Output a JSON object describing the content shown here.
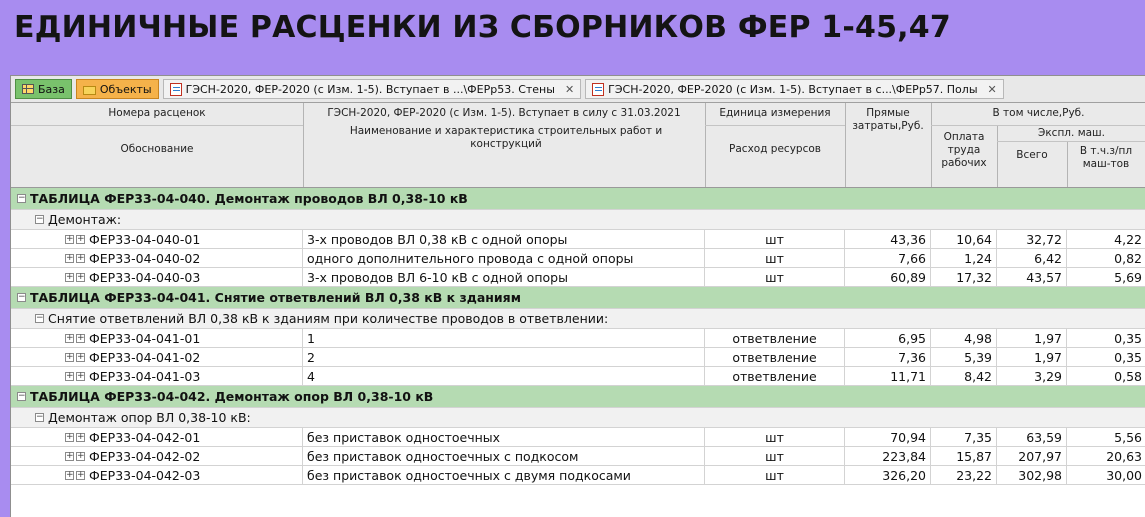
{
  "page_title": "ЕДИНИЧНЫЕ РАСЦЕНКИ ИЗ СБОРНИКОВ ФЕР 1-45,47",
  "tabs": [
    {
      "label": "База",
      "icon": "grid-icon",
      "kind": "baza"
    },
    {
      "label": "Объекты",
      "icon": "folder-icon",
      "kind": "obj"
    },
    {
      "label": "ГЭСН-2020, ФЕР-2020 (с Изм. 1-5). Вступает в ...\\ФЕРр53. Стены",
      "icon": "document-icon",
      "kind": "doc",
      "close": "✕"
    },
    {
      "label": "ГЭСН-2020, ФЕР-2020 (с Изм. 1-5). Вступает в с...\\ФЕРр57. Полы",
      "icon": "document-icon",
      "kind": "doc",
      "close": "✕"
    }
  ],
  "header": {
    "code_top": "Номера расценок",
    "code_bottom": "Обоснование",
    "name_top": "ГЭСН-2020, ФЕР-2020 (с Изм. 1-5). Вступает в силу с 31.03.2021",
    "name_bottom": "Наименование и характеристика строительных работ и конструкций",
    "unit_top": "Единица измерения",
    "unit_bottom": "Расход ресурсов",
    "direct": "Прямые затраты,Руб.",
    "incl": "В том числе,Руб.",
    "wage": "Оплата труда рабочих",
    "mach": "Экспл. маш.",
    "mach_total": "Всего",
    "mach_wage": "В т.ч.з/пл маш-тов"
  },
  "rows": [
    {
      "type": "table",
      "text": "ТАБЛИЦА ФЕР33-04-040. Демонтаж проводов ВЛ 0,38-10 кВ"
    },
    {
      "type": "group",
      "text": "Демонтаж:"
    },
    {
      "type": "item",
      "code": "ФЕР33-04-040-01",
      "name": "3-х проводов ВЛ 0,38 кВ с одной опоры",
      "unit": "шт",
      "direct": "43,36",
      "wage": "10,64",
      "mach": "32,72",
      "mach_wage": "4,22"
    },
    {
      "type": "item",
      "code": "ФЕР33-04-040-02",
      "name": "одного дополнительного провода с одной опоры",
      "unit": "шт",
      "direct": "7,66",
      "wage": "1,24",
      "mach": "6,42",
      "mach_wage": "0,82"
    },
    {
      "type": "item",
      "code": "ФЕР33-04-040-03",
      "name": "3-х проводов ВЛ 6-10 кВ с одной опоры",
      "unit": "шт",
      "direct": "60,89",
      "wage": "17,32",
      "mach": "43,57",
      "mach_wage": "5,69"
    },
    {
      "type": "table",
      "text": "ТАБЛИЦА ФЕР33-04-041. Снятие ответвлений ВЛ 0,38 кВ к зданиям"
    },
    {
      "type": "group",
      "text": "Снятие ответвлений ВЛ 0,38 кВ к зданиям при количестве проводов в ответвлении:"
    },
    {
      "type": "item",
      "code": "ФЕР33-04-041-01",
      "name": "1",
      "unit": "ответвление",
      "direct": "6,95",
      "wage": "4,98",
      "mach": "1,97",
      "mach_wage": "0,35"
    },
    {
      "type": "item",
      "code": "ФЕР33-04-041-02",
      "name": "2",
      "unit": "ответвление",
      "direct": "7,36",
      "wage": "5,39",
      "mach": "1,97",
      "mach_wage": "0,35"
    },
    {
      "type": "item",
      "code": "ФЕР33-04-041-03",
      "name": "4",
      "unit": "ответвление",
      "direct": "11,71",
      "wage": "8,42",
      "mach": "3,29",
      "mach_wage": "0,58"
    },
    {
      "type": "table",
      "text": "ТАБЛИЦА ФЕР33-04-042. Демонтаж опор ВЛ 0,38-10 кВ"
    },
    {
      "type": "group",
      "text": "Демонтаж опор ВЛ 0,38-10 кВ:"
    },
    {
      "type": "item",
      "code": "ФЕР33-04-042-01",
      "name": "без приставок одностоечных",
      "unit": "шт",
      "direct": "70,94",
      "wage": "7,35",
      "mach": "63,59",
      "mach_wage": "5,56"
    },
    {
      "type": "item",
      "code": "ФЕР33-04-042-02",
      "name": "без приставок одностоечных с подкосом",
      "unit": "шт",
      "direct": "223,84",
      "wage": "15,87",
      "mach": "207,97",
      "mach_wage": "20,63"
    },
    {
      "type": "item",
      "code": "ФЕР33-04-042-03",
      "name": "без приставок одностоечных с двумя подкосами",
      "unit": "шт",
      "direct": "326,20",
      "wage": "23,22",
      "mach": "302,98",
      "mach_wage": "30,00"
    }
  ]
}
